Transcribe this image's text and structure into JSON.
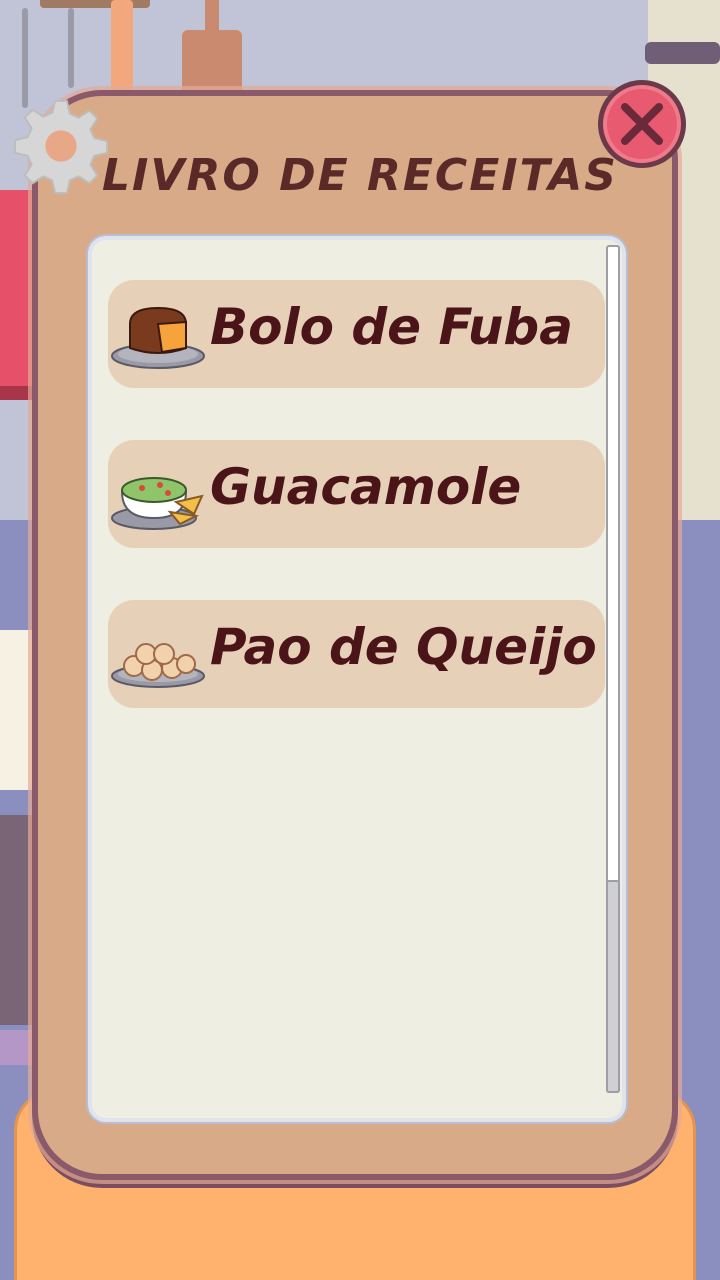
{
  "recipe_book": {
    "title": "LIVRO DE RECEITAS",
    "recipes": [
      {
        "label": "Bolo de Fuba",
        "icon": "cake-icon"
      },
      {
        "label": "Guacamole",
        "icon": "guacamole-icon"
      },
      {
        "label": "Pao de Queijo",
        "icon": "cheese-bread-icon"
      }
    ]
  },
  "colors": {
    "panel": "#d9aa88",
    "panel_border": "#8a5a6a",
    "list_background": "#eeeee2",
    "item_background": "#e6d0b8",
    "text": "#4a1418",
    "title": "#5a2a28",
    "close_button": "#e85a6f"
  },
  "icons": {
    "settings": "gear-icon",
    "close": "close-icon"
  }
}
